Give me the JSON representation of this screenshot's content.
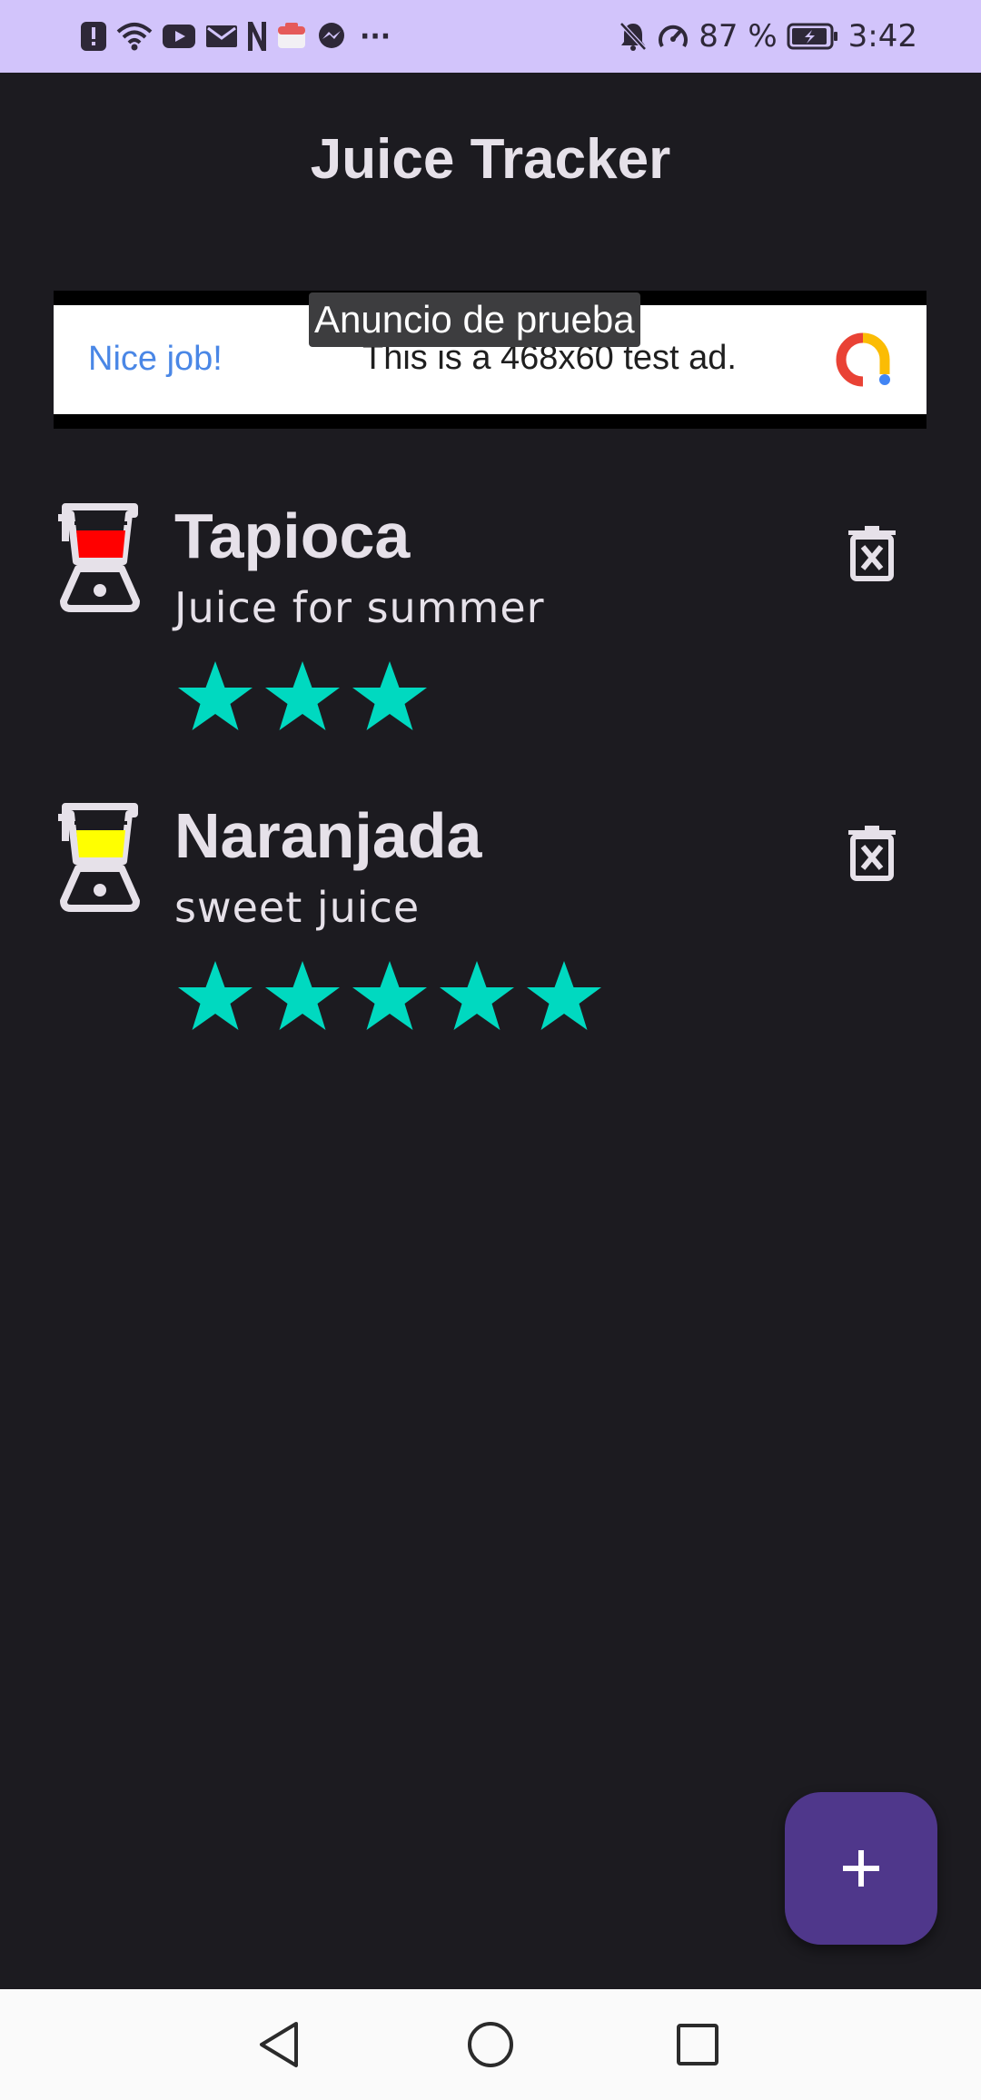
{
  "status_bar": {
    "battery_percent": "87 %",
    "time": "3:42",
    "left_icons": [
      "alert-icon",
      "wifi-icon",
      "youtube-icon",
      "mail-icon",
      "netflix-icon",
      "app-icon",
      "messenger-icon",
      "more-icon"
    ],
    "right_icons": [
      "bell-off-icon",
      "speed-icon",
      "battery-icon"
    ],
    "more_glyph": "···"
  },
  "app": {
    "title": "Juice Tracker"
  },
  "ad": {
    "label": "Anuncio de prueba",
    "headline": "Nice job!",
    "body": "This is a 468x60 test ad."
  },
  "juices": [
    {
      "name": "Tapioca",
      "description": "Juice for summer",
      "rating": 3,
      "color": "#ff0000"
    },
    {
      "name": "Naranjada",
      "description": "sweet juice",
      "rating": 5,
      "color": "#ffff00"
    }
  ],
  "colors": {
    "star": "#00d9c0",
    "accent": "#4f378b",
    "background": "#1c1b20",
    "status_bar": "#d2c4fb"
  },
  "fab": {
    "glyph": "+"
  }
}
